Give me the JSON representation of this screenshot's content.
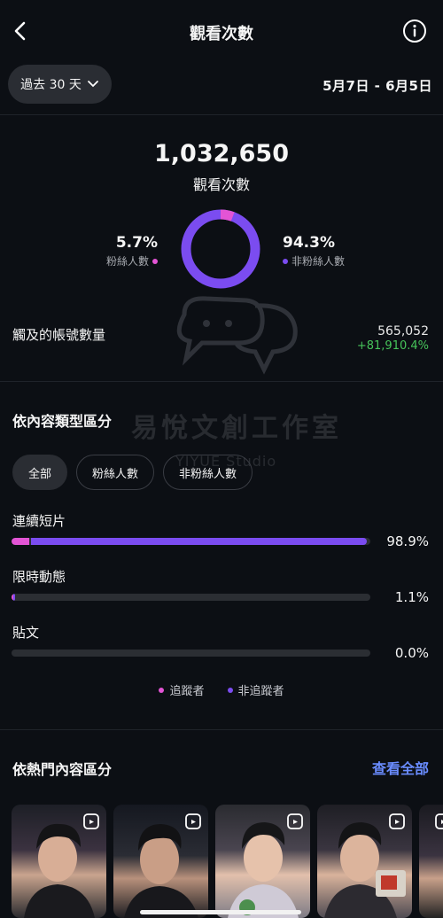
{
  "header": {
    "title": "觀看次數"
  },
  "range": {
    "label": "過去 30 天",
    "dates": "5月7日 - 6月5日"
  },
  "totals": {
    "views": "1,032,650",
    "views_label": "觀看次數"
  },
  "split": {
    "followers_pct": "5.7%",
    "followers_label": "粉絲人數",
    "nonfollowers_pct": "94.3%",
    "nonfollowers_label": "非粉絲人數",
    "followers_fraction": 0.057
  },
  "reach": {
    "label": "觸及的帳號數量",
    "value": "565,052",
    "growth": "+81,910.4%"
  },
  "content_type": {
    "title": "依內容類型區分",
    "chips": [
      "全部",
      "粉絲人數",
      "非粉絲人數"
    ],
    "rows": [
      {
        "label": "連續短片",
        "pct": "98.9%",
        "total": 0.989,
        "followers": 0.05
      },
      {
        "label": "限時動態",
        "pct": "1.1%",
        "total": 0.011,
        "followers": 0.006
      },
      {
        "label": "貼文",
        "pct": "0.0%",
        "total": 0.0,
        "followers": 0.0
      }
    ],
    "legend": {
      "followers": "追蹤者",
      "nonfollowers": "非追蹤者"
    }
  },
  "top_content": {
    "title": "依熱門內容區分",
    "see_all": "查看全部"
  },
  "watermark": {
    "text": "易悅文創工作室",
    "sub": "YIYUE Studio"
  },
  "colors": {
    "pink": "#e354d5",
    "purple": "#7b4cf0",
    "accent_blue": "#6a8cff",
    "growth_green": "#46c45a"
  }
}
